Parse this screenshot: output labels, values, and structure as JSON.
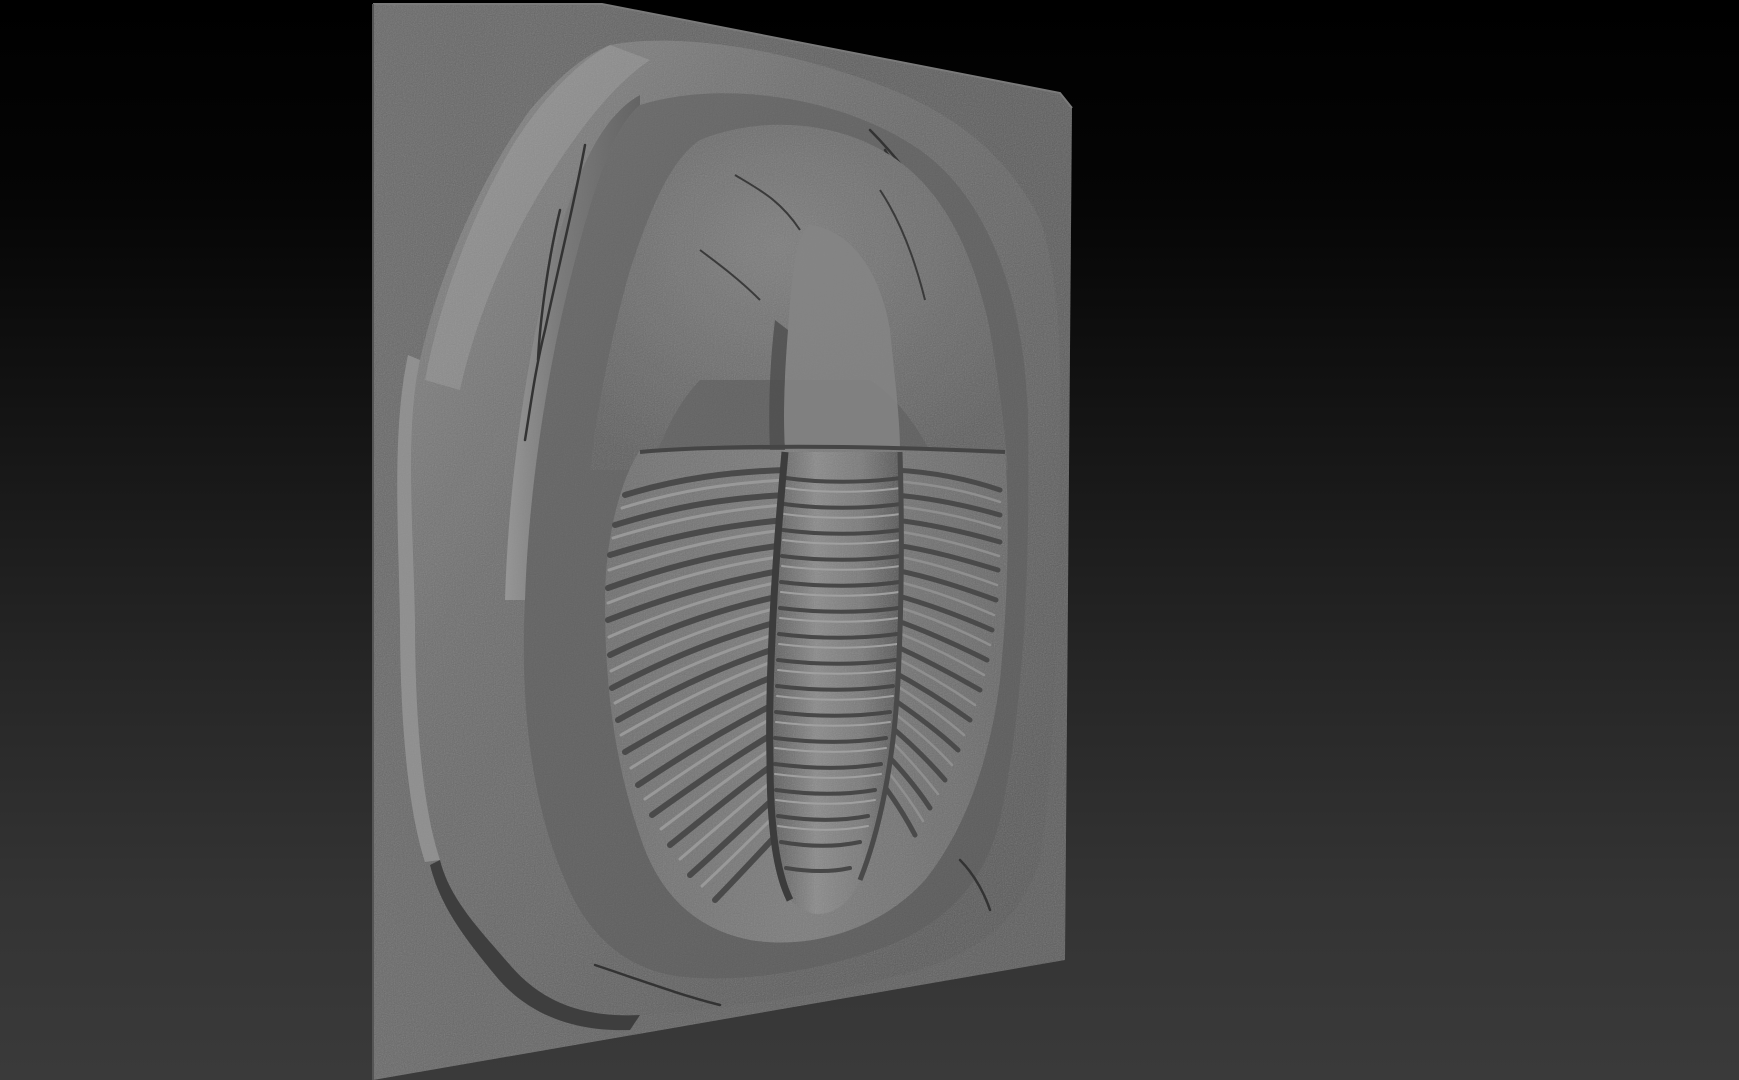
{
  "viewport": {
    "title": "",
    "background_top": "#000000",
    "background_bottom": "#3a3a3a"
  },
  "model": {
    "name": "",
    "material_color": "#6b6b6b",
    "shadow_color": "#3e3e3e",
    "highlight_color": "#9a9a9a"
  }
}
